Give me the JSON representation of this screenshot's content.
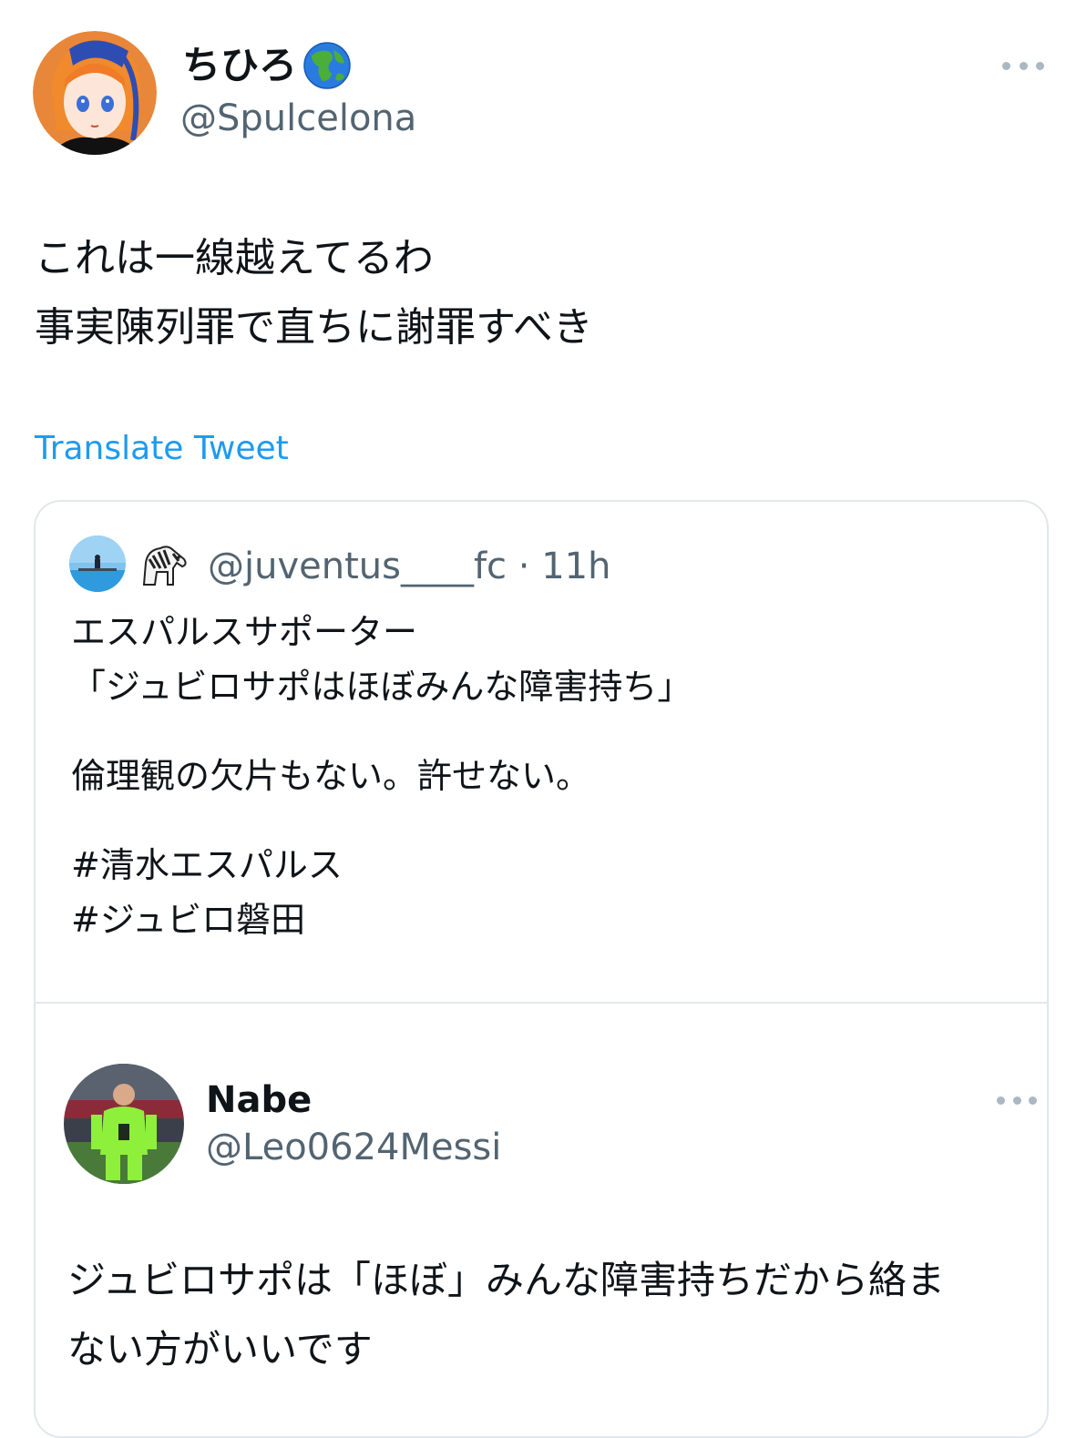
{
  "main_tweet": {
    "display_name": "ちひろ",
    "handle": "@Spulcelona",
    "text_lines": [
      "これは一線越えてるわ",
      "事実陳列罪で直ちに謝罪すべき"
    ],
    "translate_label": "Translate Tweet"
  },
  "quoted_tweet": {
    "handle": "@juventus____fc",
    "separator": "·",
    "time": "11h",
    "text_lines": [
      "エスパルスサポーター",
      "「ジュビロサポはほぼみんな障害持ち」",
      "",
      "倫理観の欠片もない。許せない。",
      "",
      "#清水エスパルス",
      "#ジュビロ磐田"
    ]
  },
  "nested_reply": {
    "display_name": "Nabe",
    "handle": "@Leo0624Messi",
    "text_lines": [
      "ジュビロサポは「ほぼ」みんな障害持ちだから絡ま",
      "ない方がいいです"
    ]
  },
  "icons": {
    "main_avatar": "anime-avatar",
    "name_emoji": "globe-asia-icon",
    "quoted_avatar": "beach-photo-avatar",
    "quoted_emoji": "zebra-icon",
    "nested_avatar": "goalkeeper-photo-avatar",
    "more": "more-dots-icon"
  },
  "colors": {
    "link": "#1d9bf0",
    "secondary_text": "#536471",
    "border": "#e1e8ed"
  }
}
